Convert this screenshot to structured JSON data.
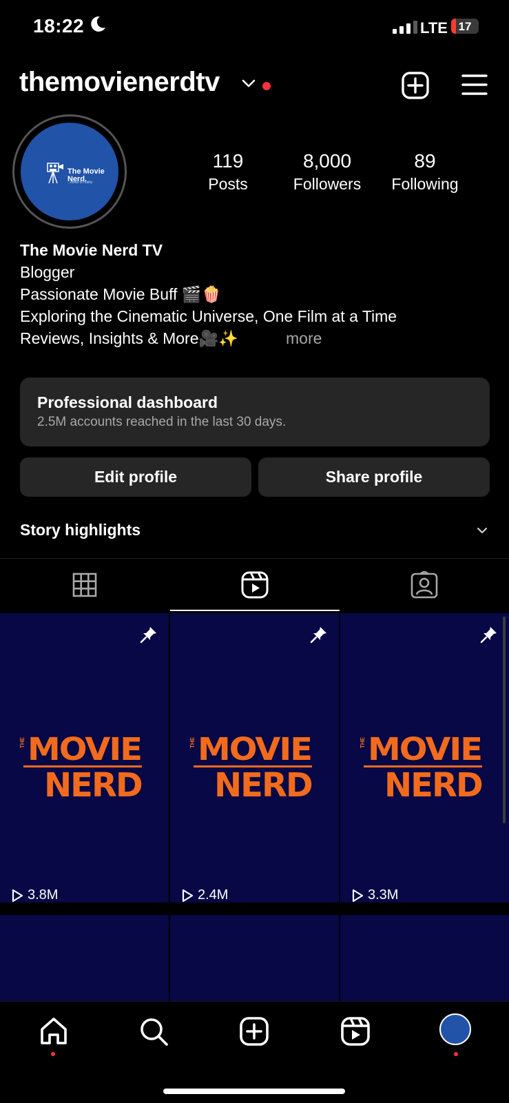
{
  "status_bar": {
    "time": "18:22",
    "network": "LTE",
    "battery": "17",
    "battery_level": 0.17,
    "icons": [
      "moon-icon",
      "signal-icon",
      "battery-icon"
    ]
  },
  "header": {
    "username": "themovienerdtv",
    "icons": [
      "chevron-down-icon",
      "plus-square-icon",
      "hamburger-menu-icon"
    ]
  },
  "profile": {
    "avatar_title": "The Movie\nNerd.",
    "avatar_tagline": "...ideas to reality",
    "stats": [
      {
        "value": "119",
        "label": "Posts"
      },
      {
        "value": "8,000",
        "label": "Followers"
      },
      {
        "value": "89",
        "label": "Following"
      }
    ],
    "display_name": "The Movie Nerd TV",
    "category": "Blogger",
    "bio_lines": [
      "Passionate Movie Buff 🎬🍿",
      "Exploring the Cinematic Universe, One Film at a Time",
      "Reviews, Insights & More🎥✨"
    ],
    "more_label": "more"
  },
  "dashboard": {
    "title": "Professional dashboard",
    "subtitle": "2.5M accounts reached in the last 30 days."
  },
  "buttons": {
    "edit_profile": "Edit profile",
    "share_profile": "Share profile"
  },
  "highlights": {
    "label": "Story highlights"
  },
  "tabs": [
    "grid-icon",
    "reels-icon",
    "tagged-icon"
  ],
  "reels": [
    {
      "views": "3.8M",
      "pinned": true,
      "logo_top": "MOVIE",
      "logo_bottom": "NERD",
      "logo_small": "THE"
    },
    {
      "views": "2.4M",
      "pinned": true,
      "logo_top": "MOVIE",
      "logo_bottom": "NERD",
      "logo_small": "THE"
    },
    {
      "views": "3.3M",
      "pinned": true,
      "logo_top": "MOVIE",
      "logo_bottom": "NERD",
      "logo_small": "THE"
    }
  ],
  "bottom_nav": [
    "home-icon",
    "search-icon",
    "create-icon",
    "reels-icon",
    "profile-avatar"
  ],
  "colors": {
    "background": "#000000",
    "card": "#262626",
    "accent_red": "#ff3040",
    "avatar_blue": "#2153a8",
    "tile_navy": "#070845",
    "logo_orange": "#f26b1d"
  }
}
